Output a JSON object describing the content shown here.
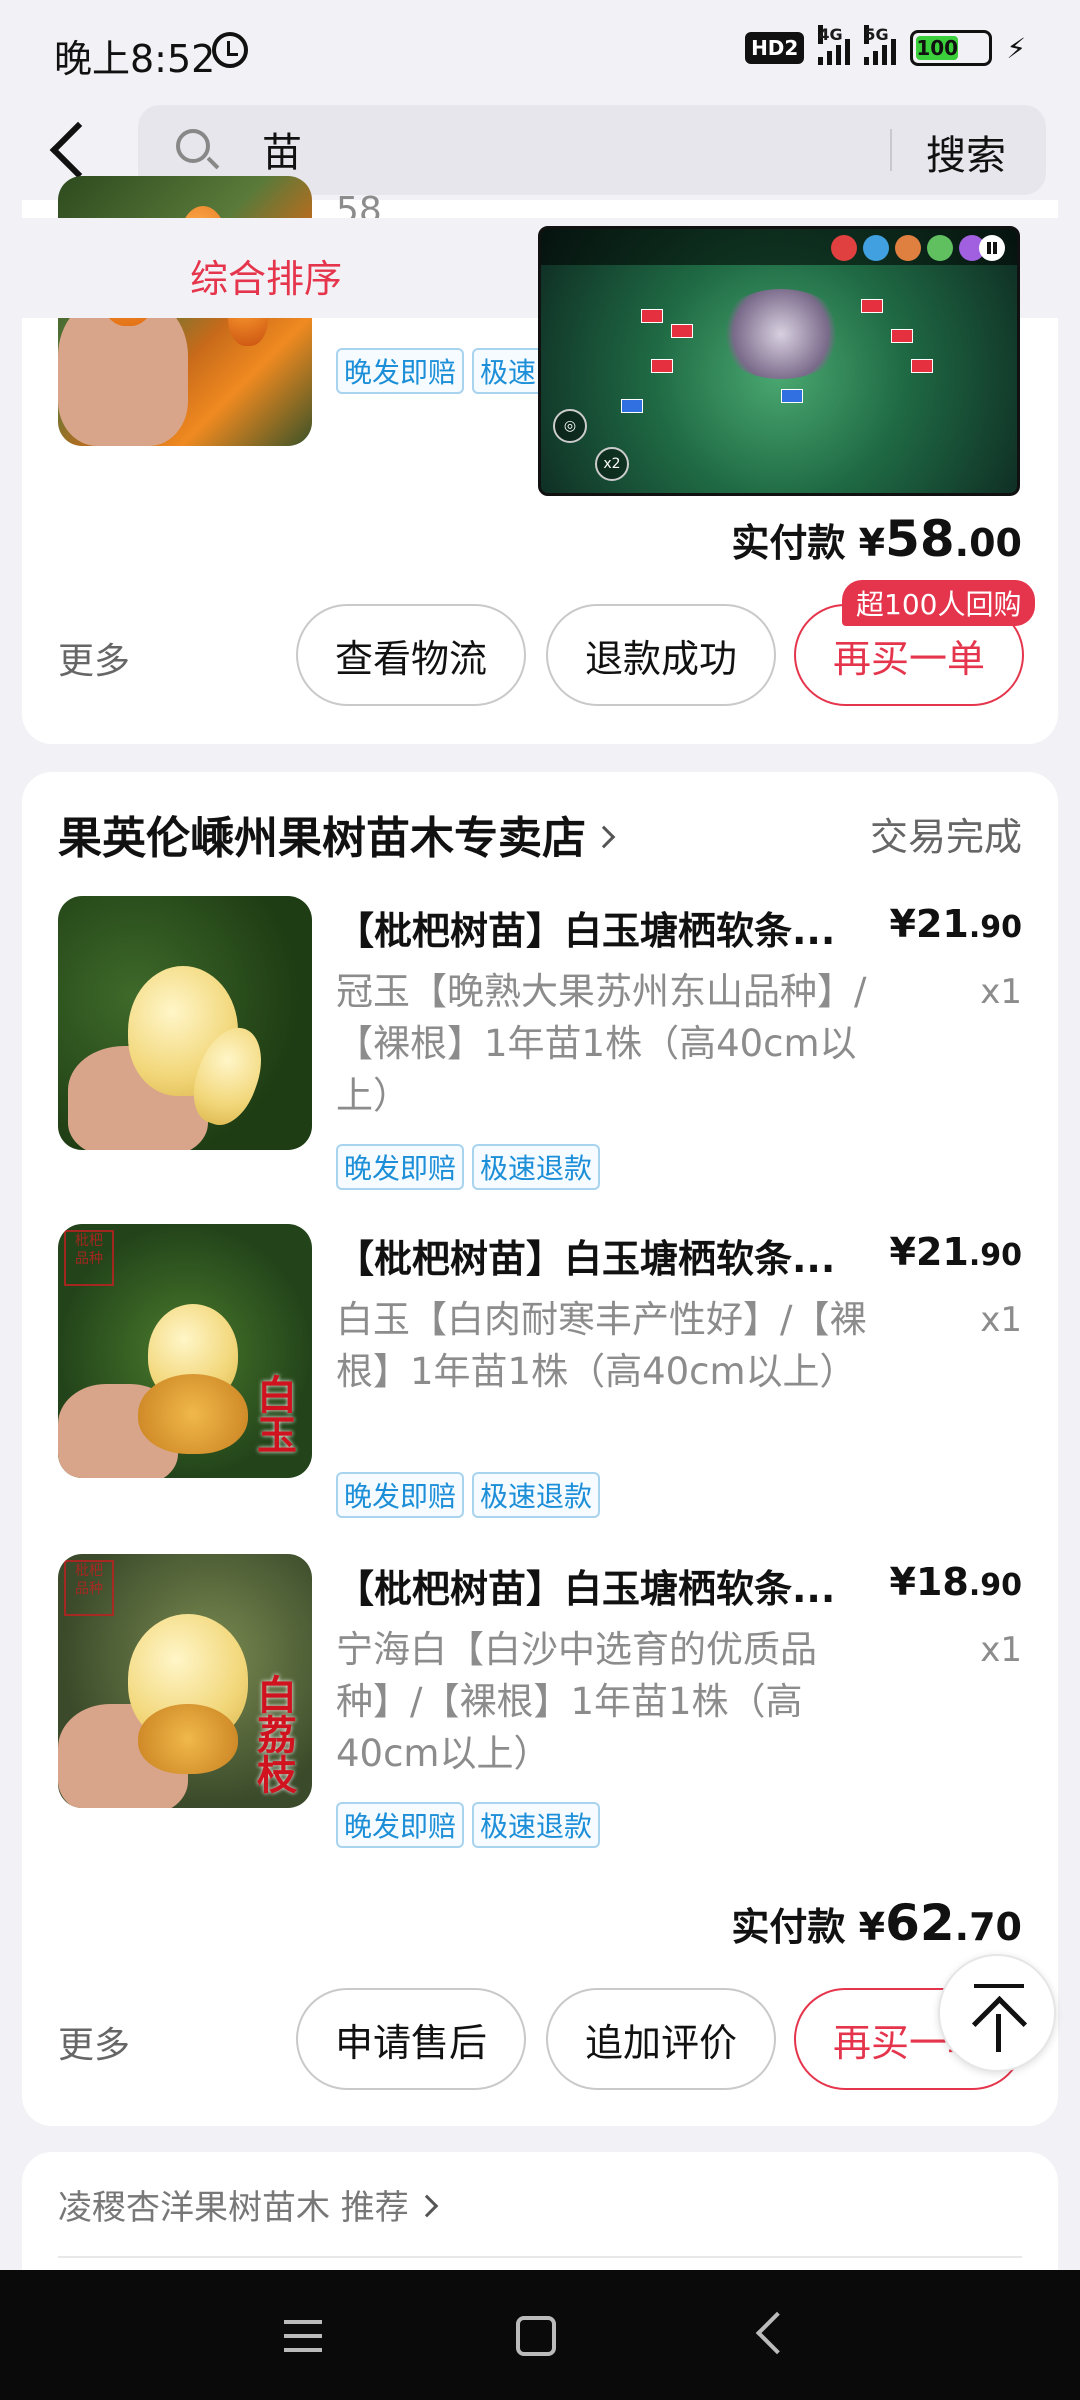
{
  "status_bar": {
    "time": "晚上8:52",
    "hd": "HD2",
    "net1": "4G",
    "net2": "5G",
    "battery": "100"
  },
  "search": {
    "query": "苗",
    "button_label": "搜索"
  },
  "sort": {
    "active_tab": "综合排序"
  },
  "order1": {
    "partial_spec": "58",
    "tags": [
      "晚发即赔",
      "极速"
    ],
    "total_label": "实付款",
    "total_currency": "¥",
    "total_amount": "58",
    "total_cents": ".00",
    "more": "更多",
    "buttons": [
      "查看物流",
      "退款成功",
      "再买一单"
    ],
    "badge": "超100人回购"
  },
  "order2": {
    "shop_name": "果英伦嵊州果树苗木专卖店",
    "status": "交易完成",
    "items": [
      {
        "title": "【枇杷树苗】白玉塘栖软条...",
        "price_currency": "¥",
        "price_main": "21",
        "price_cents": ".90",
        "spec": "冠玉【晚熟大果苏州东山品种】/【裸根】1年苗1株（高40cm以上）",
        "qty": "x1",
        "tags": [
          "晚发即赔",
          "极速退款"
        ]
      },
      {
        "title": "【枇杷树苗】白玉塘栖软条...",
        "price_currency": "¥",
        "price_main": "21",
        "price_cents": ".90",
        "spec": "白玉【白肉耐寒丰产性好】/【裸根】1年苗1株（高40cm以上）",
        "qty": "x1",
        "tags": [
          "晚发即赔",
          "极速退款"
        ],
        "image_label": "白玉"
      },
      {
        "title": "【枇杷树苗】白玉塘栖软条...",
        "price_currency": "¥",
        "price_main": "18",
        "price_cents": ".90",
        "spec": "宁海白【白沙中选育的优质品种】/【裸根】1年苗1株（高40cm以上）",
        "qty": "x1",
        "tags": [
          "晚发即赔",
          "极速退款"
        ],
        "image_label": "白荔枝"
      }
    ],
    "total_label": "实付款",
    "total_currency": "¥",
    "total_amount": "62",
    "total_cents": ".70",
    "more": "更多",
    "buttons": [
      "申请售后",
      "追加评价",
      "再买一单"
    ]
  },
  "recommend": {
    "text": "凌稷杏洋果树苗木 推荐"
  },
  "icons": {
    "back": "back-arrow-icon",
    "search": "search-icon",
    "alarm": "alarm-icon",
    "back_to_top": "back-to-top-icon"
  },
  "colors": {
    "accent": "#e5354c",
    "tag_blue": "#1d8fd8",
    "background": "#f2f2f6"
  }
}
